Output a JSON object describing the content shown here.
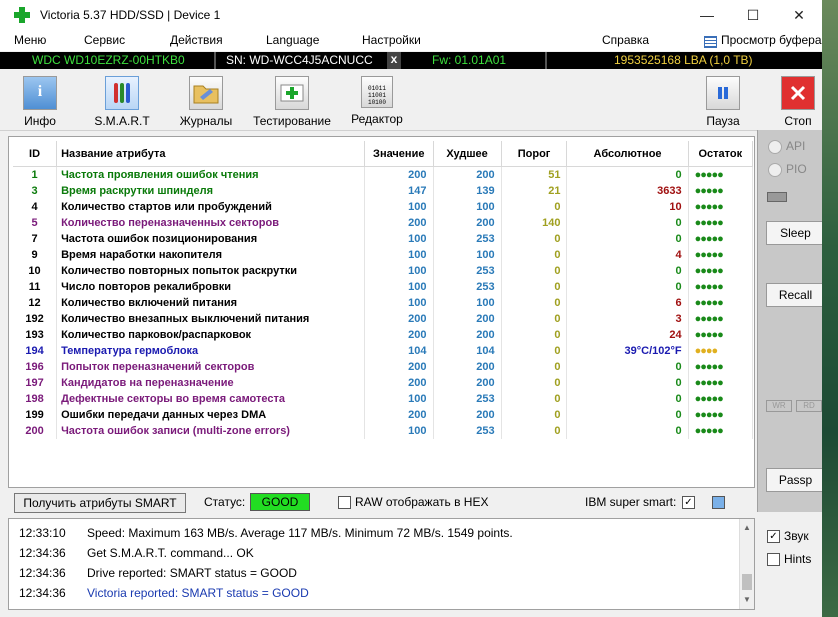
{
  "window": {
    "title": "Victoria 5.37 HDD/SSD | Device 1",
    "minimize": "—",
    "maximize": "☐",
    "close": "✕"
  },
  "menu": {
    "items": [
      "Меню",
      "Сервис",
      "Действия",
      "Language",
      "Настройки",
      "Справка"
    ],
    "viewer": "Просмотр буфера"
  },
  "device": {
    "model": "WDC WD10EZRZ-00HTKB0",
    "serial": "SN: WD-WCC4J5ACNUCC",
    "close": "x",
    "firmware": "Fw: 01.01A01",
    "lba": "1953525168 LBA (1,0 TB)"
  },
  "toolbar": {
    "info": "Инфо",
    "smart": "S.M.A.R.T",
    "logs": "Журналы",
    "test": "Тестирование",
    "editor": "Редактор",
    "pause": "Пауза",
    "stop": "Стоп",
    "editor_icon_text": "01011 11001 10100"
  },
  "smart": {
    "headers": {
      "id": "ID",
      "name": "Название атрибута",
      "value": "Значение",
      "worst": "Худшее",
      "threshold": "Порог",
      "raw": "Абсолютное",
      "remain": "Остаток"
    },
    "rows": [
      {
        "id": "1",
        "name": "Частота проявления ошибок чтения",
        "value": "200",
        "worst": "200",
        "threshold": "51",
        "raw": "0",
        "remain": "●●●●●",
        "color": "#0a7a0a"
      },
      {
        "id": "3",
        "name": "Время раскрутки шпинделя",
        "value": "147",
        "worst": "139",
        "threshold": "21",
        "raw": "3633",
        "remain": "●●●●●",
        "color": "#0a7a0a"
      },
      {
        "id": "4",
        "name": "Количество стартов или пробуждений",
        "value": "100",
        "worst": "100",
        "threshold": "0",
        "raw": "10",
        "remain": "●●●●●",
        "color": "#000000"
      },
      {
        "id": "5",
        "name": "Количество переназначенных секторов",
        "value": "200",
        "worst": "200",
        "threshold": "140",
        "raw": "0",
        "remain": "●●●●●",
        "color": "#7a1a7a"
      },
      {
        "id": "7",
        "name": "Частота ошибок позиционирования",
        "value": "100",
        "worst": "253",
        "threshold": "0",
        "raw": "0",
        "remain": "●●●●●",
        "color": "#000000"
      },
      {
        "id": "9",
        "name": "Время наработки накопителя",
        "value": "100",
        "worst": "100",
        "threshold": "0",
        "raw": "4",
        "remain": "●●●●●",
        "color": "#000000"
      },
      {
        "id": "10",
        "name": "Количество повторных попыток раскрутки",
        "value": "100",
        "worst": "253",
        "threshold": "0",
        "raw": "0",
        "remain": "●●●●●",
        "color": "#000000"
      },
      {
        "id": "11",
        "name": "Число повторов рекалибровки",
        "value": "100",
        "worst": "253",
        "threshold": "0",
        "raw": "0",
        "remain": "●●●●●",
        "color": "#000000"
      },
      {
        "id": "12",
        "name": "Количество включений питания",
        "value": "100",
        "worst": "100",
        "threshold": "0",
        "raw": "6",
        "remain": "●●●●●",
        "color": "#000000"
      },
      {
        "id": "192",
        "name": "Количество внезапных выключений питания",
        "value": "200",
        "worst": "200",
        "threshold": "0",
        "raw": "3",
        "remain": "●●●●●",
        "color": "#000000"
      },
      {
        "id": "193",
        "name": "Количество парковок/распарковок",
        "value": "200",
        "worst": "200",
        "threshold": "0",
        "raw": "24",
        "remain": "●●●●●",
        "color": "#000000"
      },
      {
        "id": "194",
        "name": "Температура гермоблока",
        "value": "104",
        "worst": "104",
        "threshold": "0",
        "raw": "39°C/102°F",
        "remain": "●●●●",
        "color": "#1a1ab0"
      },
      {
        "id": "196",
        "name": "Попыток переназначений секторов",
        "value": "200",
        "worst": "200",
        "threshold": "0",
        "raw": "0",
        "remain": "●●●●●",
        "color": "#7a1a7a"
      },
      {
        "id": "197",
        "name": "Кандидатов на переназначение",
        "value": "200",
        "worst": "200",
        "threshold": "0",
        "raw": "0",
        "remain": "●●●●●",
        "color": "#7a1a7a"
      },
      {
        "id": "198",
        "name": "Дефектные секторы во время самотеста",
        "value": "100",
        "worst": "253",
        "threshold": "0",
        "raw": "0",
        "remain": "●●●●●",
        "color": "#7a1a7a"
      },
      {
        "id": "199",
        "name": "Ошибки передачи данных через DMA",
        "value": "200",
        "worst": "200",
        "threshold": "0",
        "raw": "0",
        "remain": "●●●●●",
        "color": "#000000"
      },
      {
        "id": "200",
        "name": "Частота ошибок записи (multi-zone errors)",
        "value": "100",
        "worst": "253",
        "threshold": "0",
        "raw": "0",
        "remain": "●●●●●",
        "color": "#7a1a7a"
      }
    ]
  },
  "side": {
    "api": "API",
    "pio": "PIO",
    "sleep": "Sleep",
    "recall": "Recall",
    "wr": "WR",
    "rd": "RD",
    "passp": "Passp"
  },
  "status": {
    "get_button": "Получить атрибуты SMART",
    "status_label": "Статус:",
    "status_value": "GOOD",
    "raw_hex": "RAW отображать в HEX",
    "ibm": "IBM super smart:",
    "ibm_checked": "✓"
  },
  "log": [
    {
      "time": "12:33:10",
      "msg": "Speed: Maximum 163 MB/s. Average 117 MB/s. Minimum 72 MB/s. 1549 points.",
      "color": "#000000"
    },
    {
      "time": "12:34:36",
      "msg": "Get S.M.A.R.T. command... OK",
      "color": "#000000"
    },
    {
      "time": "12:34:36",
      "msg": "Drive reported: SMART status = GOOD",
      "color": "#000000"
    },
    {
      "time": "12:34:36",
      "msg": "Victoria reported: SMART status = GOOD",
      "color": "#1a3ab0"
    }
  ],
  "options": {
    "sound": "Звук",
    "sound_checked": "✓",
    "hints": "Hints"
  }
}
